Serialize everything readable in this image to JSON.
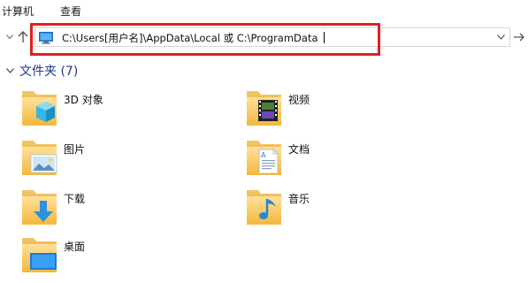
{
  "ribbon": {
    "tabs": [
      "计算机",
      "查看"
    ]
  },
  "address_bar": {
    "path": "C:\\Users[用户名]\\AppData\\Local 或 C:\\ProgramData"
  },
  "section": {
    "title": "文件夹 (7)"
  },
  "folders": [
    {
      "label": "3D 对象",
      "icon": "3d-objects-icon"
    },
    {
      "label": "视频",
      "icon": "videos-icon"
    },
    {
      "label": "图片",
      "icon": "pictures-icon"
    },
    {
      "label": "文档",
      "icon": "documents-icon"
    },
    {
      "label": "下载",
      "icon": "downloads-icon"
    },
    {
      "label": "音乐",
      "icon": "music-icon"
    },
    {
      "label": "桌面",
      "icon": "desktop-icon"
    }
  ],
  "colors": {
    "highlight": "#e0201f",
    "section_title": "#1e3a8a",
    "folder": "#f5c04f"
  }
}
